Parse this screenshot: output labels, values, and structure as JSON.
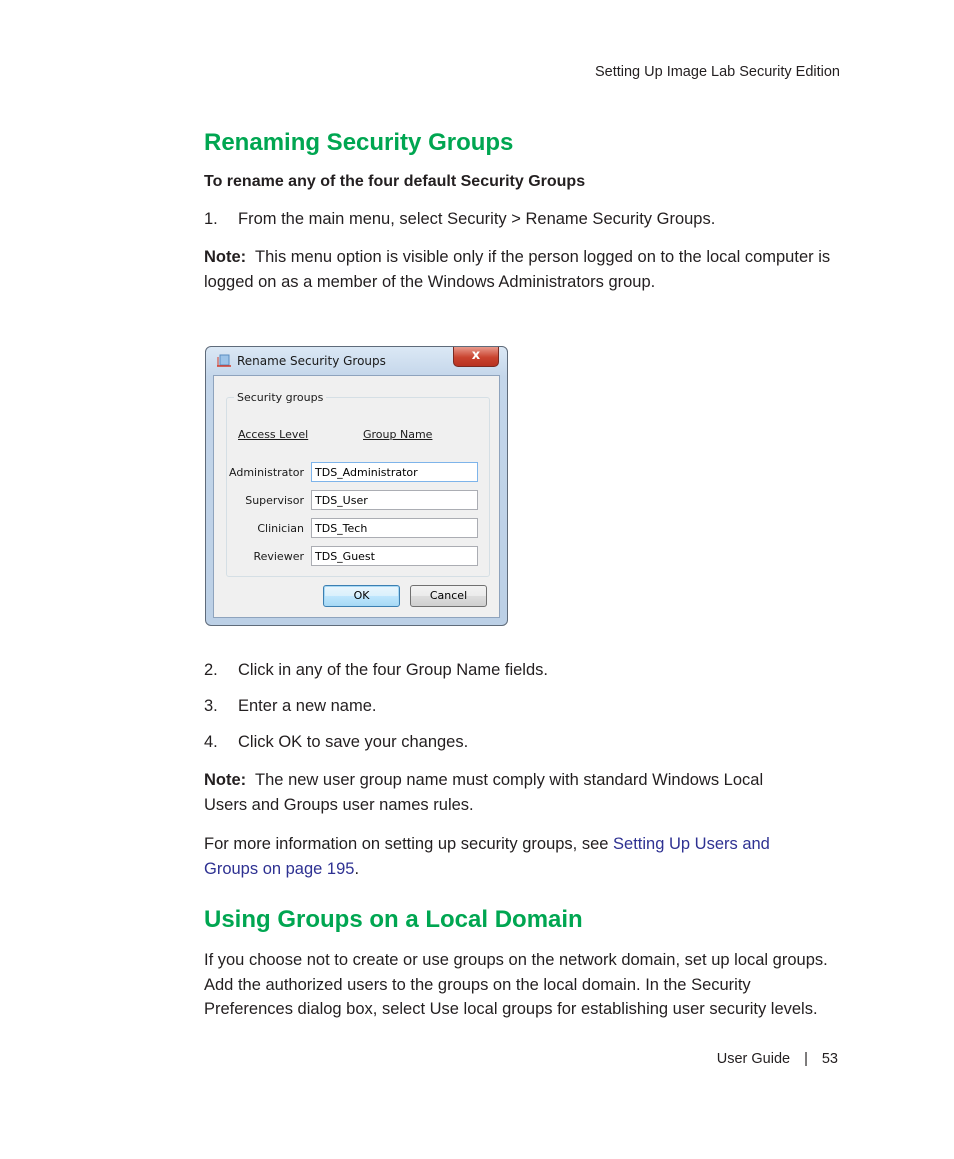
{
  "running_head": "Setting Up Image Lab Security Edition",
  "section1": {
    "heading": "Renaming Security Groups",
    "procedure_title": "To rename any of the four default Security Groups",
    "step1": {
      "num": "1.",
      "text": "From the main menu, select Security > Rename Security Groups."
    },
    "note1": {
      "label": "Note:",
      "text": "This menu option is visible only if the person logged on to the local computer is logged on as a member of the Windows Administrators group."
    },
    "dialog": {
      "title": "Rename Security Groups",
      "close_label": "x",
      "groupbox_label": "Security groups",
      "col_access_level": "Access Level",
      "col_group_name": "Group Name",
      "rows": [
        {
          "level": "Administrator",
          "name": "TDS_Administrator"
        },
        {
          "level": "Supervisor",
          "name": "TDS_User"
        },
        {
          "level": "Clinician",
          "name": "TDS_Tech"
        },
        {
          "level": "Reviewer",
          "name": "TDS_Guest"
        }
      ],
      "ok_label": "OK",
      "cancel_label": "Cancel"
    },
    "step2": {
      "num": "2.",
      "text": "Click in any of the four Group Name fields."
    },
    "step3": {
      "num": "3.",
      "text": "Enter a new name."
    },
    "step4": {
      "num": "4.",
      "text": "Click OK to save your changes."
    },
    "note2": {
      "label": "Note:",
      "text": "The new user group name must comply with standard Windows Local Users and Groups user names rules."
    },
    "more_info": {
      "text": "For more information on setting up security groups, see ",
      "link": "Setting Up Users and Groups on page 195",
      "end": "."
    }
  },
  "section2": {
    "heading": "Using Groups on a Local Domain",
    "body": "If you choose not to create or use groups on the network domain, set up local groups. Add the authorized users to the groups on the local domain. In the Security Preferences dialog box, select Use local groups for establishing user security levels."
  },
  "footer": {
    "label": "User Guide",
    "separator": "|",
    "page": "53"
  },
  "colors": {
    "heading": "#00a651",
    "link": "#2e3192",
    "text": "#231f20"
  }
}
